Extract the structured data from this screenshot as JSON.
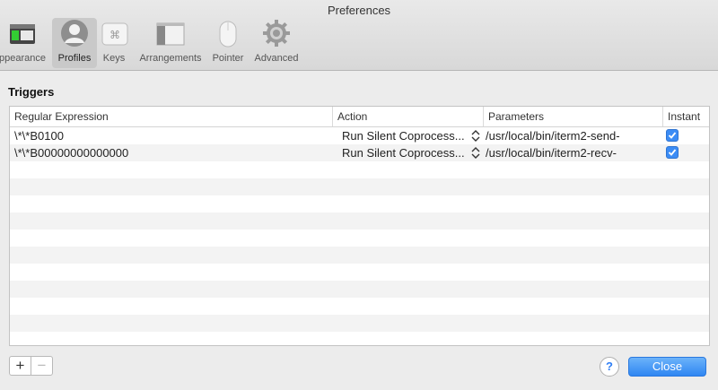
{
  "window": {
    "title": "Preferences"
  },
  "toolbar": {
    "items": [
      {
        "label": "ppearance",
        "icon": "appearance-icon"
      },
      {
        "label": "Profiles",
        "icon": "profiles-icon",
        "selected": true
      },
      {
        "label": "Keys",
        "icon": "keys-icon"
      },
      {
        "label": "Arrangements",
        "icon": "arrangements-icon"
      },
      {
        "label": "Pointer",
        "icon": "pointer-icon"
      },
      {
        "label": "Advanced",
        "icon": "gear-icon"
      }
    ]
  },
  "triggers": {
    "title": "Triggers",
    "columns": [
      "Regular Expression",
      "Action",
      "Parameters",
      "Instant"
    ],
    "rows": [
      {
        "regex": "\\*\\*B0100",
        "action": "Run Silent Coprocess...",
        "parameters": "/usr/local/bin/iterm2-send-",
        "instant": true
      },
      {
        "regex": "\\*\\*B00000000000000",
        "action": "Run Silent Coprocess...",
        "parameters": "/usr/local/bin/iterm2-recv-",
        "instant": true
      }
    ]
  },
  "footer": {
    "add_label": "+",
    "remove_label": "−",
    "help_label": "?",
    "close_label": "Close"
  },
  "colors": {
    "accent": "#3b8cf5",
    "window_bg": "#ececec"
  }
}
